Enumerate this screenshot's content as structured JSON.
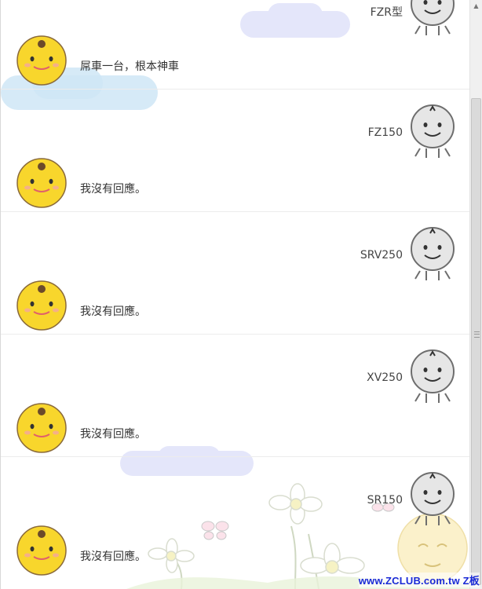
{
  "conversation": [
    {
      "user": "FZR型",
      "bot": "屌車一台，根本神車"
    },
    {
      "user": "FZ150",
      "bot": "我沒有回應。"
    },
    {
      "user": "SRV250",
      "bot": "我沒有回應。"
    },
    {
      "user": "XV250",
      "bot": "我沒有回應。"
    },
    {
      "user": "SR150",
      "bot": "我沒有回應。"
    }
  ],
  "watermark": "www.ZCLUB.com.tw Z板",
  "icons": {
    "user_avatar": "grey-smiley-avatar-icon",
    "bot_avatar": "yellow-chick-avatar-icon"
  },
  "colors": {
    "bot_avatar": "#f8d62c",
    "user_avatar": "#e6e6e6",
    "watermark": "#1a2ad6",
    "cloud": "#cfe6f6"
  }
}
